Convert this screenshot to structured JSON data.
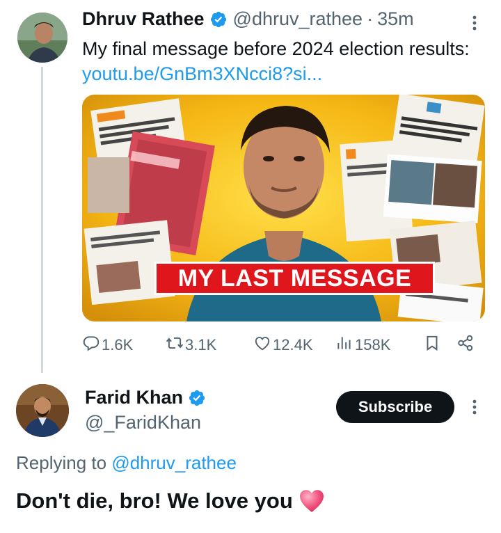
{
  "parent_tweet": {
    "author_name": "Dhruv Rathee",
    "handle": "@dhruv_rathee",
    "separator": "·",
    "time": "35m",
    "text_before_link": "My final message before 2024 election results: ",
    "link_text": "youtu.be/GnBm3XNcci8?si...",
    "media": {
      "thumbnail_caption": "MY LAST MESSAGE"
    },
    "actions": {
      "replies": "1.6K",
      "reposts": "3.1K",
      "likes": "12.4K",
      "views": "158K"
    }
  },
  "reply_tweet": {
    "author_name": "Farid Khan",
    "handle": "@_FaridKhan",
    "subscribe_label": "Subscribe",
    "replying_to_prefix": "Replying to ",
    "replying_to_handle": "@dhruv_rathee",
    "text": "Don't die, bro! We love you"
  },
  "colors": {
    "accent": "#1d9bf0",
    "secondary_text": "#536471",
    "primary_text": "#0f1419",
    "thumbnail_red": "#e0161d",
    "thumbnail_yellow": "#f6c21a"
  },
  "icons": [
    "verified-badge-icon",
    "more-options-icon",
    "reply-icon",
    "repost-icon",
    "like-icon",
    "views-icon",
    "bookmark-icon",
    "share-icon",
    "heart-emoji-icon"
  ]
}
